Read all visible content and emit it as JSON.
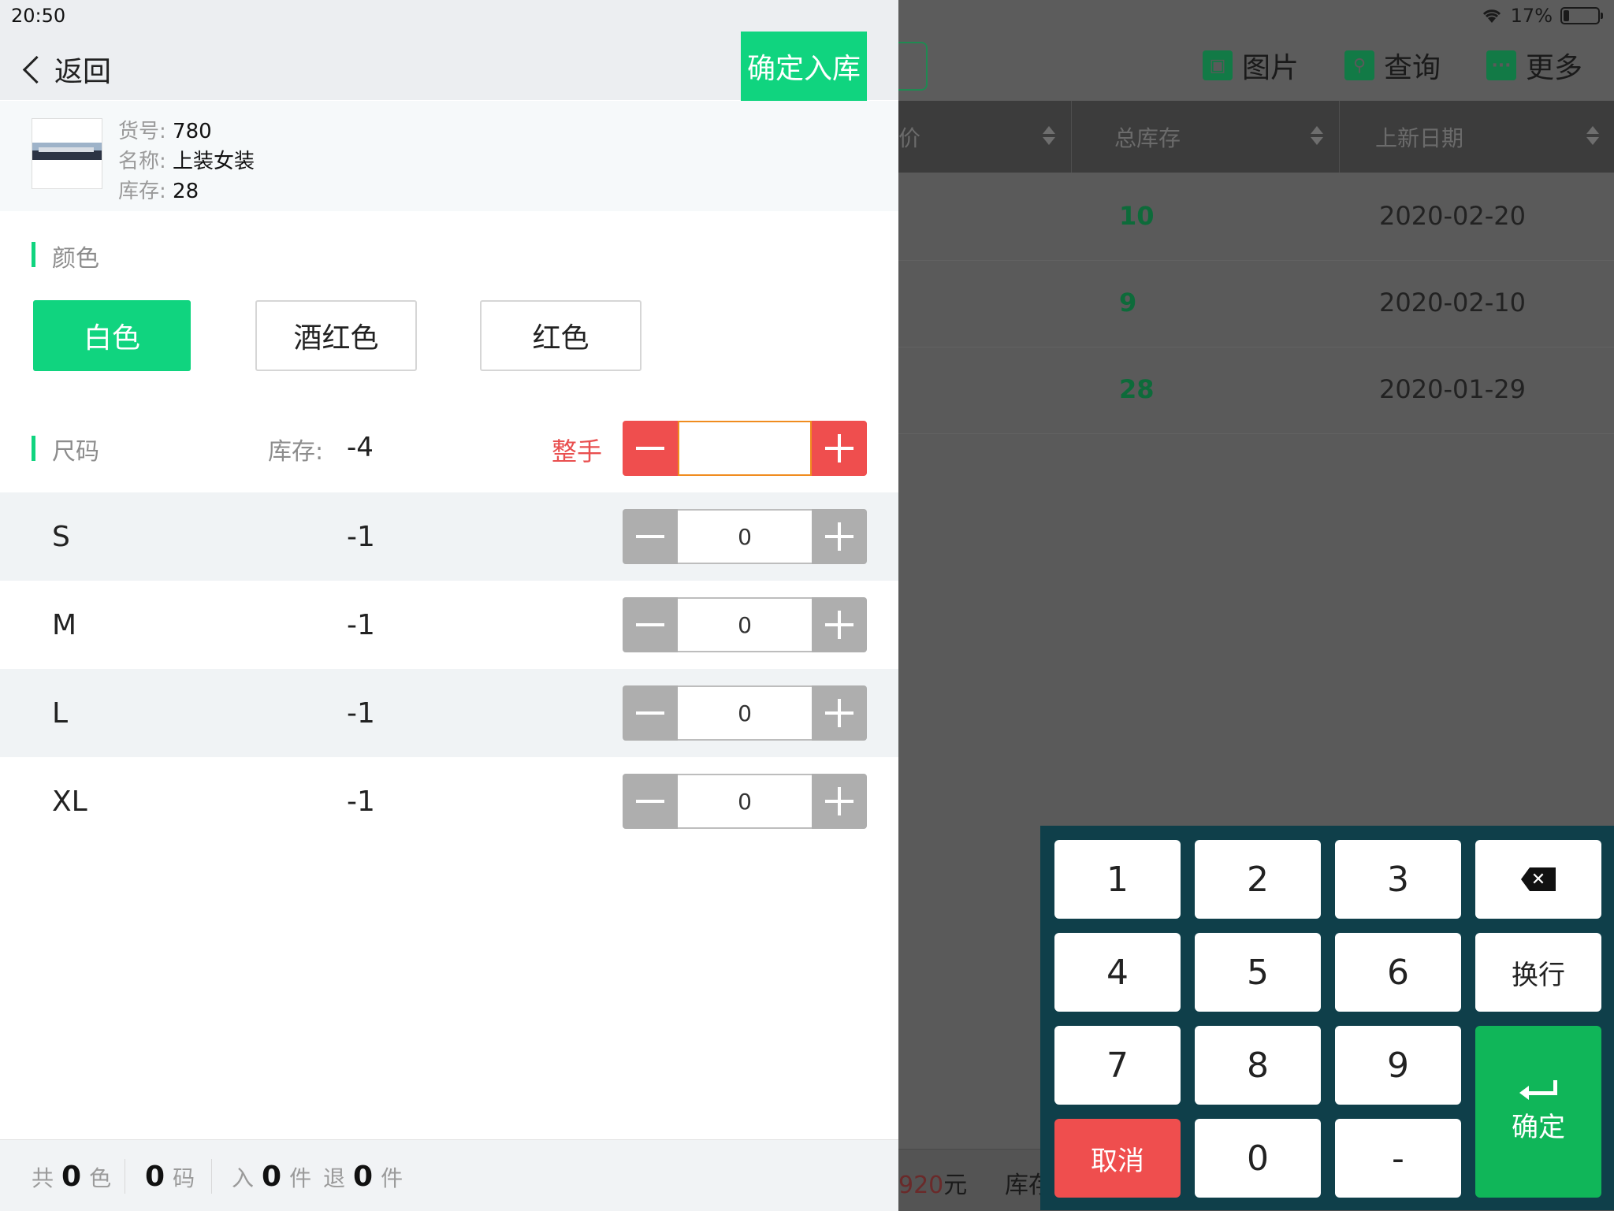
{
  "status": {
    "time": "20:50",
    "battery": "17%"
  },
  "background_page": {
    "toolbar": [
      {
        "label": "图片",
        "icon": "image-icon"
      },
      {
        "label": "查询",
        "icon": "search-icon"
      },
      {
        "label": "更多",
        "icon": "more-icon"
      }
    ],
    "columns": [
      "价",
      "总库存",
      "上新日期"
    ],
    "rows": [
      {
        "stock": "10",
        "date": "2020-02-20"
      },
      {
        "stock": "9",
        "date": "2020-02-10"
      },
      {
        "stock": "28",
        "date": "2020-01-29"
      }
    ],
    "footer": {
      "amount": "920",
      "amount_unit": "元",
      "stock_label": "库存"
    }
  },
  "nav": {
    "back_label": "返回",
    "confirm_label": "确定入库"
  },
  "product": {
    "code_label": "货号:",
    "code": "780",
    "name_label": "名称:",
    "name": "上装女装",
    "stock_label": "库存:",
    "stock": "28"
  },
  "color_section": {
    "title": "颜色",
    "options": [
      {
        "label": "白色",
        "selected": true
      },
      {
        "label": "酒红色",
        "selected": false
      },
      {
        "label": "红色",
        "selected": false
      }
    ]
  },
  "size_section": {
    "title": "尺码",
    "stock_label": "库存:",
    "stock": "-4",
    "whole_label": "整手",
    "whole_value": "",
    "sizes": [
      {
        "size": "S",
        "stock": "-1",
        "qty": "0"
      },
      {
        "size": "M",
        "stock": "-1",
        "qty": "0"
      },
      {
        "size": "L",
        "stock": "-1",
        "qty": "0"
      },
      {
        "size": "XL",
        "stock": "-1",
        "qty": "0"
      }
    ]
  },
  "footer": {
    "total_prefix": "共",
    "colors": "0",
    "colors_unit": "色",
    "sizes": "0",
    "sizes_unit": "码",
    "in_label": "入",
    "in_count": "0",
    "in_unit": "件",
    "return_label": "退",
    "return_count": "0",
    "return_unit": "件"
  },
  "keypad": {
    "keys": [
      "1",
      "2",
      "3",
      "4",
      "5",
      "6",
      "7",
      "8",
      "9",
      "0",
      "-"
    ],
    "newline_label": "换行",
    "cancel_label": "取消",
    "confirm_label": "确定",
    "backspace_icon": "backspace-icon",
    "enter_icon": "enter-icon"
  },
  "colors": {
    "accent": "#10d47f",
    "danger": "#ef4e4e",
    "keypad_bg": "#0f3f4a",
    "enter": "#10b659"
  }
}
